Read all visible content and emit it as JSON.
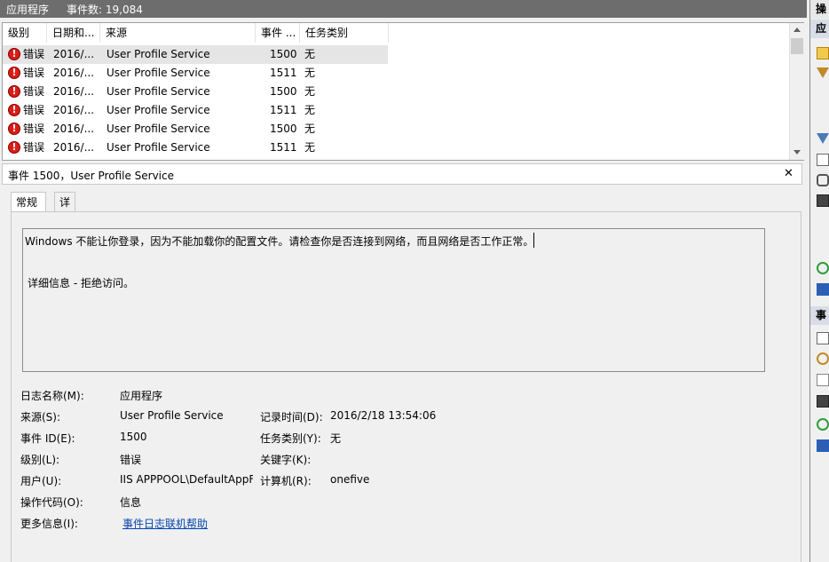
{
  "titlebar": {
    "title": "应用程序",
    "event_count": "事件数: 19,084"
  },
  "list": {
    "columns": [
      "级别",
      "日期和...",
      "来源",
      "事件 ...",
      "任务类别"
    ],
    "rows": [
      {
        "level": "错误",
        "date": "2016/...",
        "source": "User Profile Service",
        "event": "1500",
        "task": "无"
      },
      {
        "level": "错误",
        "date": "2016/...",
        "source": "User Profile Service",
        "event": "1511",
        "task": "无"
      },
      {
        "level": "错误",
        "date": "2016/...",
        "source": "User Profile Service",
        "event": "1500",
        "task": "无"
      },
      {
        "level": "错误",
        "date": "2016/...",
        "source": "User Profile Service",
        "event": "1511",
        "task": "无"
      },
      {
        "level": "错误",
        "date": "2016/...",
        "source": "User Profile Service",
        "event": "1500",
        "task": "无"
      },
      {
        "level": "错误",
        "date": "2016/...",
        "source": "User Profile Service",
        "event": "1511",
        "task": "无"
      }
    ]
  },
  "detail": {
    "title": "事件 1500，User Profile Service",
    "close": "✕",
    "tabs": [
      "常规",
      "详细信息"
    ],
    "message_line1": "Windows 不能让你登录，因为不能加载你的配置文件。请检查你是否连接到网络，而且网络是否工作正常。",
    "message_line2": "详细信息 - 拒绝访问。",
    "fields": {
      "log_name_label": "日志名称(M):",
      "log_name": "应用程序",
      "source_label": "来源(S):",
      "source": "User Profile Service",
      "logged_label": "记录时间(D):",
      "logged": "2016/2/18 13:54:06",
      "event_id_label": "事件 ID(E):",
      "event_id": "1500",
      "task_label": "任务类别(Y):",
      "task": "无",
      "level_label": "级别(L):",
      "level": "错误",
      "keywords_label": "关键字(K):",
      "user_label": "用户(U):",
      "user": "IIS APPPOOL\\DefaultAppF",
      "computer_label": "计算机(R):",
      "computer": "onefive",
      "opcode_label": "操作代码(O):",
      "opcode": "信息",
      "more_info_label": "更多信息(I):",
      "more_info_link": "事件日志联机帮助"
    }
  },
  "right_panel": {
    "header1": "操作",
    "header2": "应",
    "header3": "事",
    "icons": [
      "open-folder-icon",
      "filter-icon",
      "filter-icon",
      "properties-icon",
      "find-icon",
      "save-icon",
      "refresh-icon",
      "help-icon",
      "event-properties-icon",
      "attach-task-icon",
      "copy-icon",
      "save-icon",
      "refresh-icon",
      "help-icon"
    ]
  }
}
